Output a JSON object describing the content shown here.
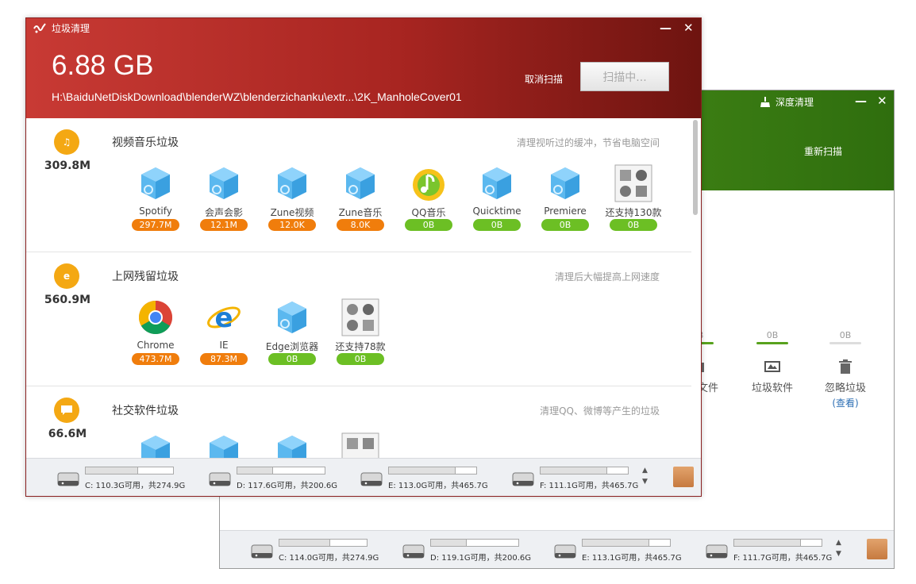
{
  "back_window": {
    "title": "深度清理",
    "minimize": "—",
    "close": "✕",
    "rescan_label": "重新扫描",
    "categories": [
      {
        "size": "0B",
        "label": "垃圾文件"
      },
      {
        "size": "0B",
        "label": "垃圾软件"
      },
      {
        "size": "0B",
        "label": "忽略垃圾",
        "link": "(查看)"
      }
    ],
    "drives": [
      {
        "text": "C: 114.0G可用，共274.9G",
        "used_pct": 58
      },
      {
        "text": "D: 119.1G可用，共200.6G",
        "used_pct": 41
      },
      {
        "text": "E: 113.1G可用，共465.7G",
        "used_pct": 76
      },
      {
        "text": "F: 111.7G可用，共465.7G",
        "used_pct": 76
      }
    ]
  },
  "front_window": {
    "app_title": "垃圾清理",
    "minimize": "—",
    "close": "✕",
    "total_size": "6.88 GB",
    "scan_path": "H:\\BaiduNetDiskDownload\\blenderWZ\\blenderzichanku\\extr...\\2K_ManholeCover01",
    "cancel_label": "取消扫描",
    "scanning_label": "扫描中...",
    "sections": [
      {
        "icon": "music-note-icon",
        "icon_glyph": "♫",
        "total": "309.8M",
        "title": "视频音乐垃圾",
        "desc": "清理视听过的缓冲，节省电脑空间",
        "items": [
          {
            "name": "Spotify",
            "size": "297.7M",
            "status": "orange",
            "icon": "cube"
          },
          {
            "name": "会声会影",
            "size": "12.1M",
            "status": "orange",
            "icon": "cube"
          },
          {
            "name": "Zune视频",
            "size": "12.0K",
            "status": "orange",
            "icon": "cube"
          },
          {
            "name": "Zune音乐",
            "size": "8.0K",
            "status": "orange",
            "icon": "cube"
          },
          {
            "name": "QQ音乐",
            "size": "0B",
            "status": "green",
            "icon": "qqmusic"
          },
          {
            "name": "Quicktime",
            "size": "0B",
            "status": "green",
            "icon": "cube"
          },
          {
            "name": "Premiere",
            "size": "0B",
            "status": "green",
            "icon": "cube"
          },
          {
            "name": "还支持130款",
            "size": "0B",
            "status": "green",
            "icon": "grid"
          }
        ]
      },
      {
        "icon": "ie-logo-icon",
        "icon_glyph": "e",
        "total": "560.9M",
        "title": "上网残留垃圾",
        "desc": "清理后大幅提高上网速度",
        "items": [
          {
            "name": "Chrome",
            "size": "473.7M",
            "status": "orange",
            "icon": "chrome"
          },
          {
            "name": "IE",
            "size": "87.3M",
            "status": "orange",
            "icon": "ie"
          },
          {
            "name": "Edge浏览器",
            "size": "0B",
            "status": "green",
            "icon": "cube"
          },
          {
            "name": "还支持78款",
            "size": "0B",
            "status": "green",
            "icon": "grid"
          }
        ]
      },
      {
        "icon": "chat-bubble-icon",
        "icon_glyph": "▬",
        "total": "66.6M",
        "title": "社交软件垃圾",
        "desc": "清理QQ、微博等产生的垃圾",
        "items": [
          {
            "name": "",
            "size": "",
            "status": "orange",
            "icon": "cube"
          },
          {
            "name": "",
            "size": "",
            "status": "orange",
            "icon": "cube"
          },
          {
            "name": "",
            "size": "",
            "status": "orange",
            "icon": "cube"
          },
          {
            "name": "",
            "size": "",
            "status": "green",
            "icon": "grid"
          }
        ]
      }
    ],
    "drives": [
      {
        "text": "C: 110.3G可用，共274.9G",
        "used_pct": 60
      },
      {
        "text": "D: 117.6G可用，共200.6G",
        "used_pct": 41
      },
      {
        "text": "E: 113.0G可用，共465.7G",
        "used_pct": 76
      },
      {
        "text": "F: 111.1G可用，共465.7G",
        "used_pct": 76
      }
    ]
  }
}
